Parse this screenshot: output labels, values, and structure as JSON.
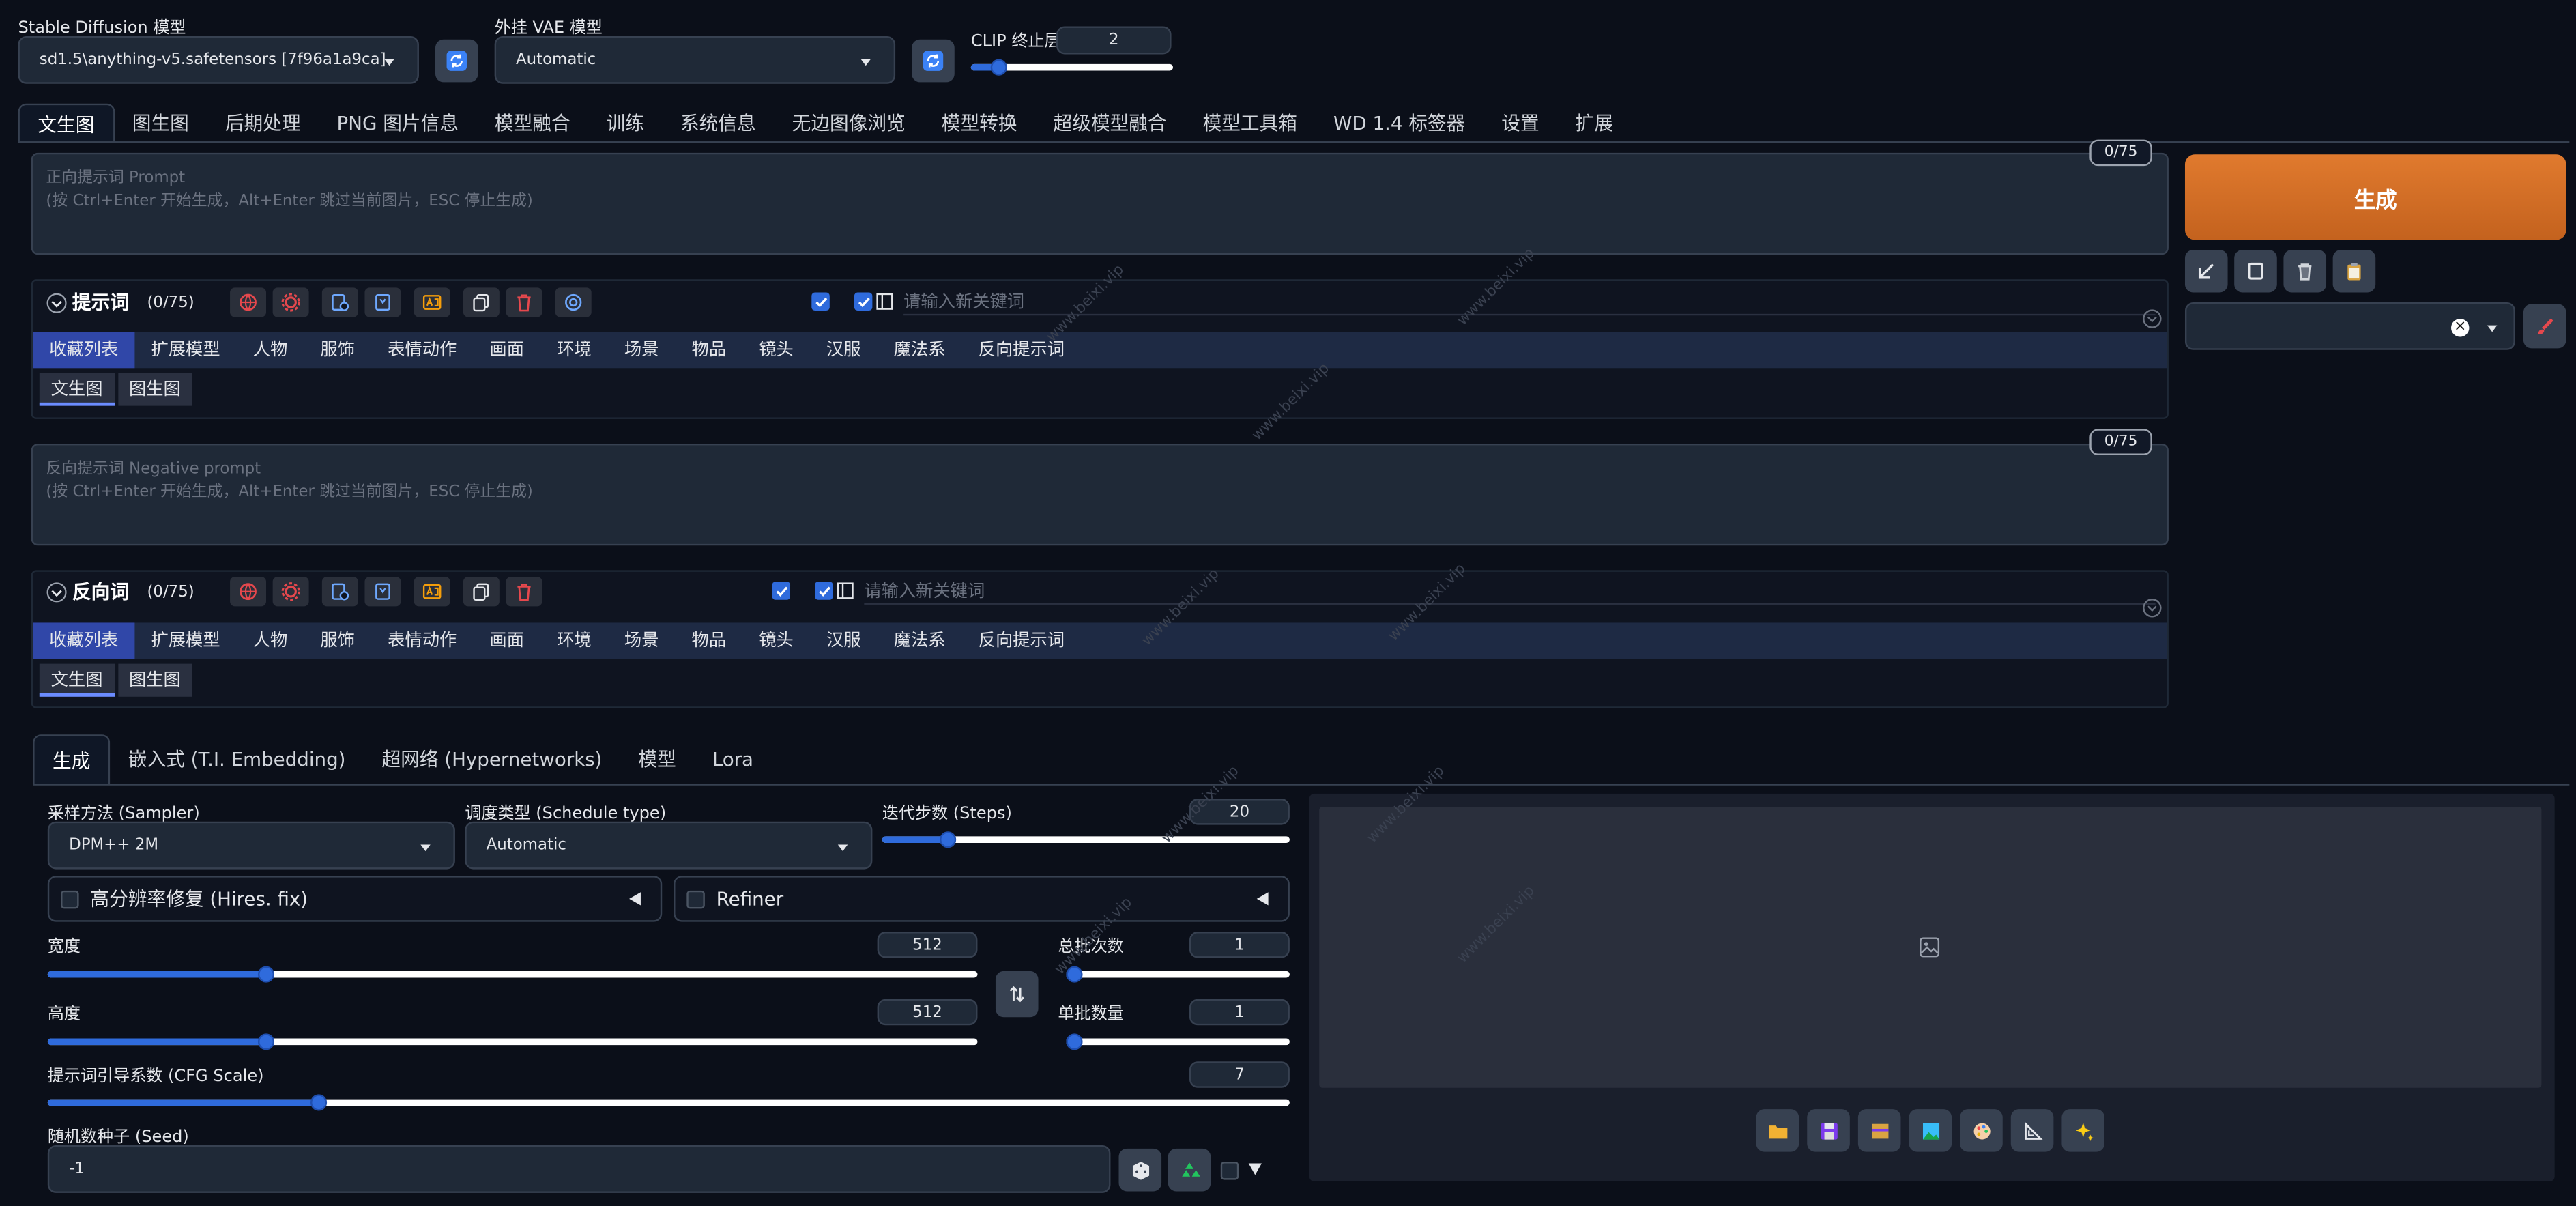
{
  "top": {
    "sd_model_label": "Stable Diffusion 模型",
    "sd_model_value": "sd1.5\\anything-v5.safetensors [7f96a1a9ca]",
    "vae_label": "外挂 VAE 模型",
    "vae_value": "Automatic",
    "clip_label": "CLIP 终止层数",
    "clip_value": 2,
    "clip_fraction": 0.11
  },
  "main_tabs": [
    "文生图",
    "图生图",
    "后期处理",
    "PNG 图片信息",
    "模型融合",
    "训练",
    "系统信息",
    "无边图像浏览",
    "模型转换",
    "超级模型融合",
    "模型工具箱",
    "WD 1.4 标签器",
    "设置",
    "扩展"
  ],
  "prompt": {
    "placeholder_line1": "正向提示词 Prompt",
    "placeholder_line2": "(按 Ctrl+Enter 开始生成，Alt+Enter 跳过当前图片，ESC 停止生成)",
    "counter": "0/75",
    "panel_title": "提示词",
    "panel_count": "(0/75)",
    "keyword_placeholder": "请输入新关键词"
  },
  "negative": {
    "placeholder_line1": "反向提示词 Negative prompt",
    "placeholder_line2": "(按 Ctrl+Enter 开始生成，Alt+Enter 跳过当前图片，ESC 停止生成)",
    "counter": "0/75",
    "panel_title": "反向词",
    "panel_count": "(0/75)",
    "keyword_placeholder": "请输入新关键词"
  },
  "categories": [
    "收藏列表",
    "扩展模型",
    "人物",
    "服饰",
    "表情动作",
    "画面",
    "环境",
    "场景",
    "物品",
    "镜头",
    "汉服",
    "魔法系",
    "反向提示词"
  ],
  "subtabs": [
    "文生图",
    "图生图"
  ],
  "generate_button": "生成",
  "gen_tabs": [
    "生成",
    "嵌入式 (T.I. Embedding)",
    "超网络 (Hypernetworks)",
    "模型",
    "Lora"
  ],
  "params": {
    "sampler_label": "采样方法 (Sampler)",
    "sampler_value": "DPM++ 2M",
    "schedule_label": "调度类型 (Schedule type)",
    "schedule_value": "Automatic",
    "steps_label": "迭代步数 (Steps)",
    "steps_value": 20,
    "steps_fraction": 0.147,
    "hires_label": "高分辨率修复 (Hires. fix)",
    "refiner_label": "Refiner",
    "width_label": "宽度",
    "width_value": 512,
    "width_fraction": 0.231,
    "height_label": "高度",
    "height_value": 512,
    "height_fraction": 0.231,
    "batch_count_label": "总批次数",
    "batch_count_value": 1,
    "batch_count_fraction": 0.0,
    "batch_size_label": "单批数量",
    "batch_size_value": 1,
    "batch_size_fraction": 0.0,
    "cfg_label": "提示词引导系数 (CFG Scale)",
    "cfg_value": 7,
    "cfg_fraction": 0.214,
    "seed_label": "随机数种子 (Seed)",
    "seed_value": "-1"
  },
  "watermark": "www.beixi.vip"
}
